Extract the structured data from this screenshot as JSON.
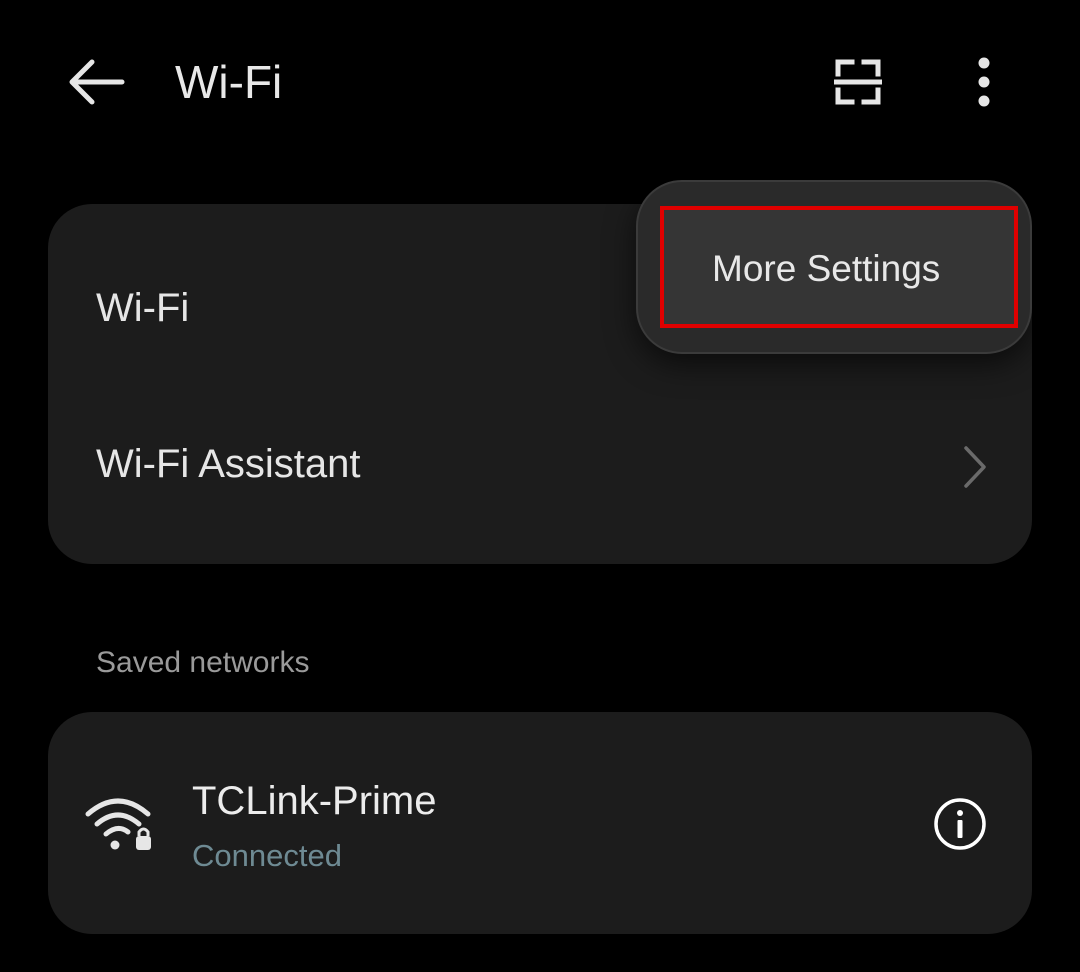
{
  "header": {
    "title": "Wi-Fi",
    "back_icon": "back-arrow-icon",
    "scan_icon": "scan-icon",
    "more_icon": "more-vertical-icon"
  },
  "settings": {
    "rows": [
      {
        "label": "Wi-Fi"
      },
      {
        "label": "Wi-Fi Assistant",
        "trailing_icon": "chevron-right-icon"
      }
    ]
  },
  "dropdown": {
    "items": [
      {
        "label": "More Settings",
        "highlighted": true,
        "highlight_color": "#e00000"
      }
    ]
  },
  "saved_networks": {
    "title": "Saved networks",
    "networks": [
      {
        "name": "TCLink-Prime",
        "status": "Connected",
        "icon": "wifi-lock-icon",
        "trailing_icon": "info-icon"
      }
    ]
  },
  "colors": {
    "background": "#000000",
    "card": "#1c1c1c",
    "status_text": "#6e8a93",
    "highlight": "#e00000"
  }
}
